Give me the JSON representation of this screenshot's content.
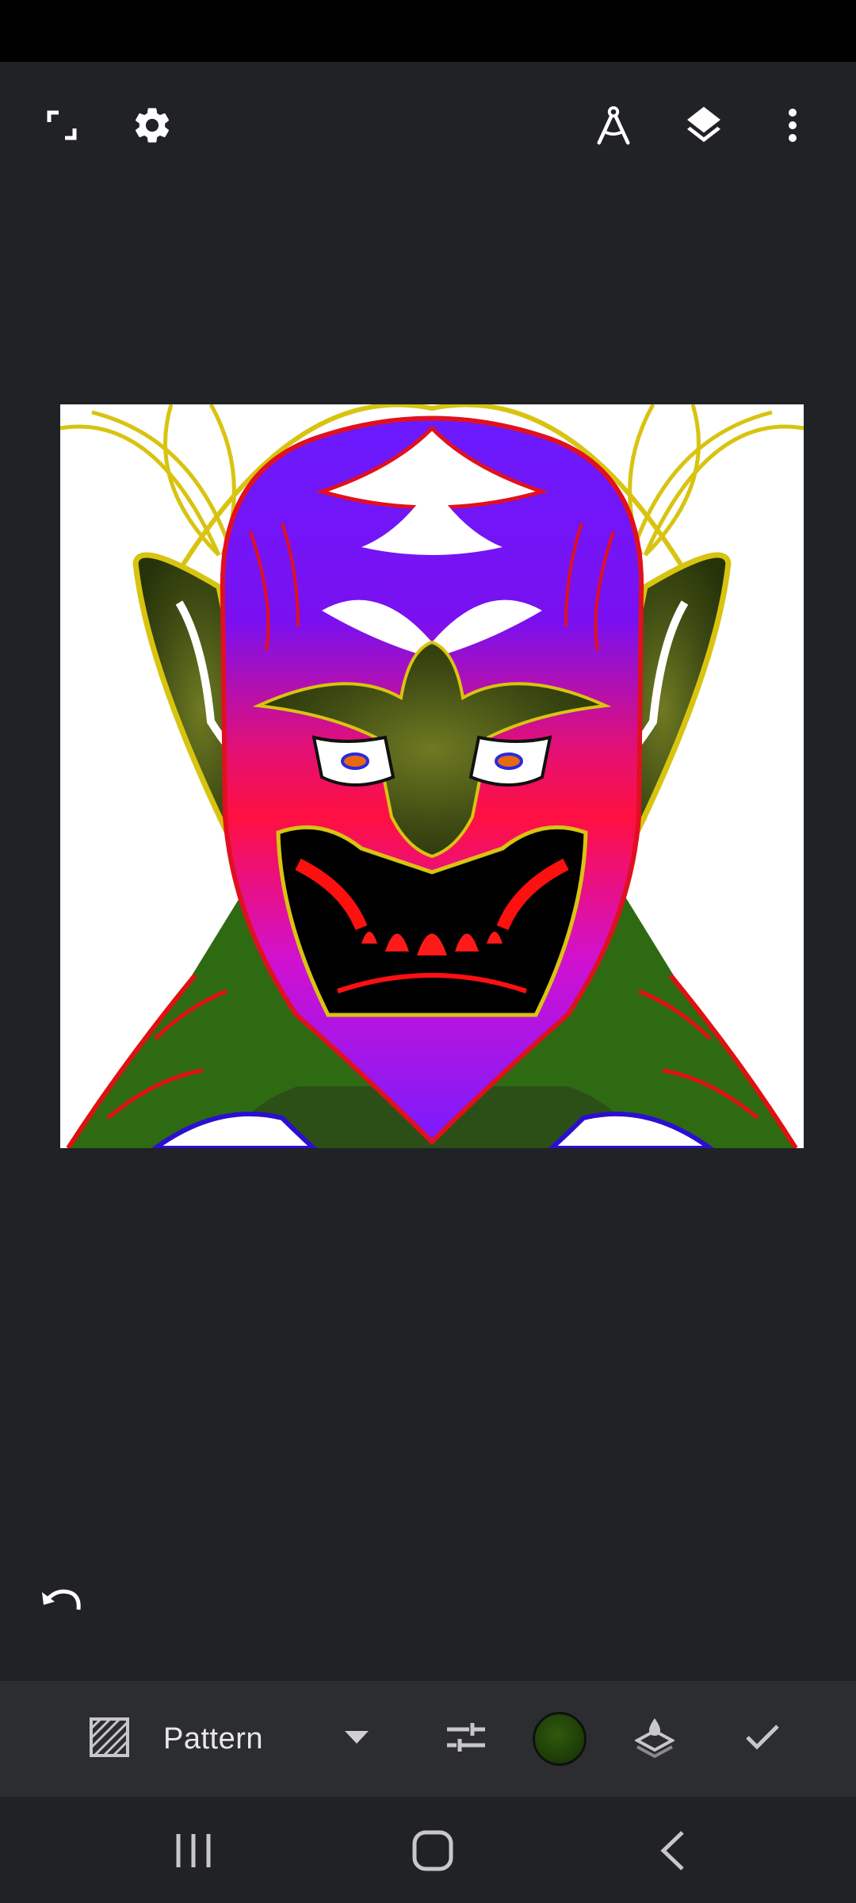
{
  "toolbar": {
    "left": [
      {
        "icon": "fullscreen-icon"
      },
      {
        "icon": "gear-icon"
      }
    ],
    "right": [
      {
        "icon": "compass-icon"
      },
      {
        "icon": "layers-icon"
      },
      {
        "icon": "more-vert-icon"
      }
    ]
  },
  "canvas": {
    "description_hidden": "",
    "background": "#ffffff"
  },
  "bottom_toolbar": {
    "mode_icon": "pattern-icon",
    "mode_label": "Pattern",
    "dropdown_icon": "chevron-down-icon",
    "adjust_icon": "sliders-icon",
    "color": "#2a4d0b",
    "blend_icon": "layer-fill-icon",
    "confirm_icon": "check-icon"
  },
  "nav": {
    "recents_icon": "recents-icon",
    "home_icon": "home-icon",
    "back_icon": "back-icon"
  },
  "colors": {
    "background": "#212225",
    "toolbar_bg": "#2c2d31",
    "icon": "#ffffff"
  }
}
